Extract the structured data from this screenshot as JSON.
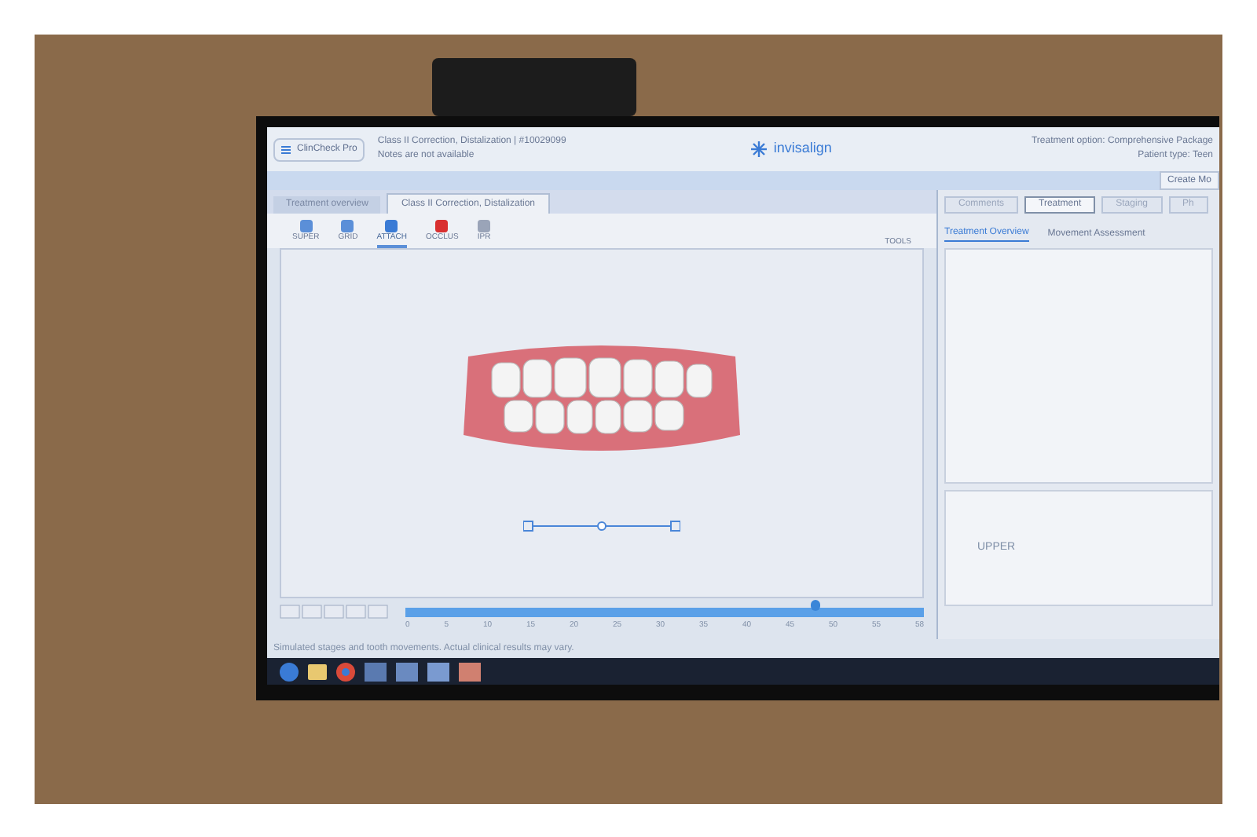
{
  "app": {
    "menu_button": "ClinCheck Pro",
    "case_title": "Class II Correction, Distalization | #10029099",
    "notes": "Notes are not available",
    "brand": "invisalign",
    "treatment_option": "Treatment option: Comprehensive Package",
    "patient_type": "Patient type: Teen",
    "create_button": "Create Mo"
  },
  "tabs": [
    {
      "label": "Treatment overview",
      "selected": false
    },
    {
      "label": "Class II Correction, Distalization",
      "selected": true
    }
  ],
  "tools": [
    {
      "label": "SUPER",
      "selected": false
    },
    {
      "label": "GRID",
      "selected": false
    },
    {
      "label": "ATTACH",
      "selected": true
    },
    {
      "label": "OCCLUS",
      "selected": false
    },
    {
      "label": "IPR",
      "selected": false
    }
  ],
  "tools_button": "TOOLS",
  "panel_tabs": [
    {
      "label": "Comments",
      "selected": false
    },
    {
      "label": "Treatment",
      "selected": true
    },
    {
      "label": "Staging",
      "selected": false
    },
    {
      "label": "Ph",
      "selected": false
    }
  ],
  "panel_subtabs": [
    {
      "label": "Treatment Overview",
      "selected": true
    },
    {
      "label": "Movement Assessment",
      "selected": false
    }
  ],
  "panel_chart_label": "UPPER",
  "timeline": {
    "level": 0.79,
    "ticks": [
      "0",
      "5",
      "10",
      "15",
      "20",
      "25",
      "30",
      "35",
      "40",
      "45",
      "50",
      "55",
      "58"
    ]
  },
  "disclaimer": "Simulated stages and tooth movements. Actual clinical results may vary."
}
